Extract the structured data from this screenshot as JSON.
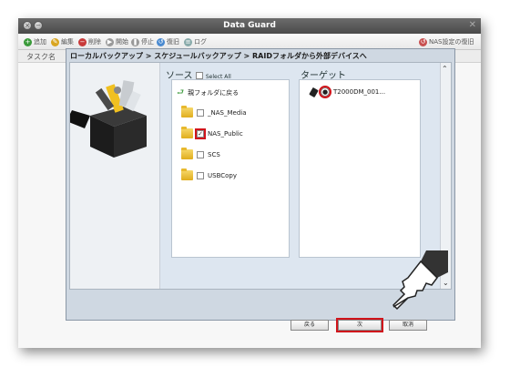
{
  "window": {
    "title": "Data Guard"
  },
  "toolbar": {
    "items": [
      {
        "label": "追加",
        "icon": "plus-icon"
      },
      {
        "label": "編集",
        "icon": "edit-icon"
      },
      {
        "label": "削除",
        "icon": "delete-icon"
      },
      {
        "label": "開始",
        "icon": "play-icon"
      },
      {
        "label": "停止",
        "icon": "pause-icon"
      },
      {
        "label": "復旧",
        "icon": "restore-icon"
      },
      {
        "label": "ログ",
        "icon": "log-icon"
      }
    ],
    "right_label": "NAS設定の復旧"
  },
  "grid": {
    "column_header": "タスク名"
  },
  "dialog": {
    "breadcrumb": "ローカルバックアップ > スケジュールバックアップ > RAIDフォルダから外部デバイスへ",
    "source": {
      "title": "ソース",
      "select_all": "Select All",
      "parent_folder": "親フォルダに戻る",
      "folders": [
        {
          "name": "_NAS_Media",
          "checked": false
        },
        {
          "name": "NAS_Public",
          "checked": true
        },
        {
          "name": "SCS",
          "checked": false
        },
        {
          "name": "USBCopy",
          "checked": false
        }
      ]
    },
    "target": {
      "title": "ターゲット",
      "device": "T2000DM_001..."
    },
    "buttons": {
      "back": "戻る",
      "next": "次",
      "cancel": "取消"
    }
  },
  "colors": {
    "highlight": "#d0141b",
    "titlebar": "#5a5a5a",
    "dialog_bg": "#cfd8e2"
  }
}
